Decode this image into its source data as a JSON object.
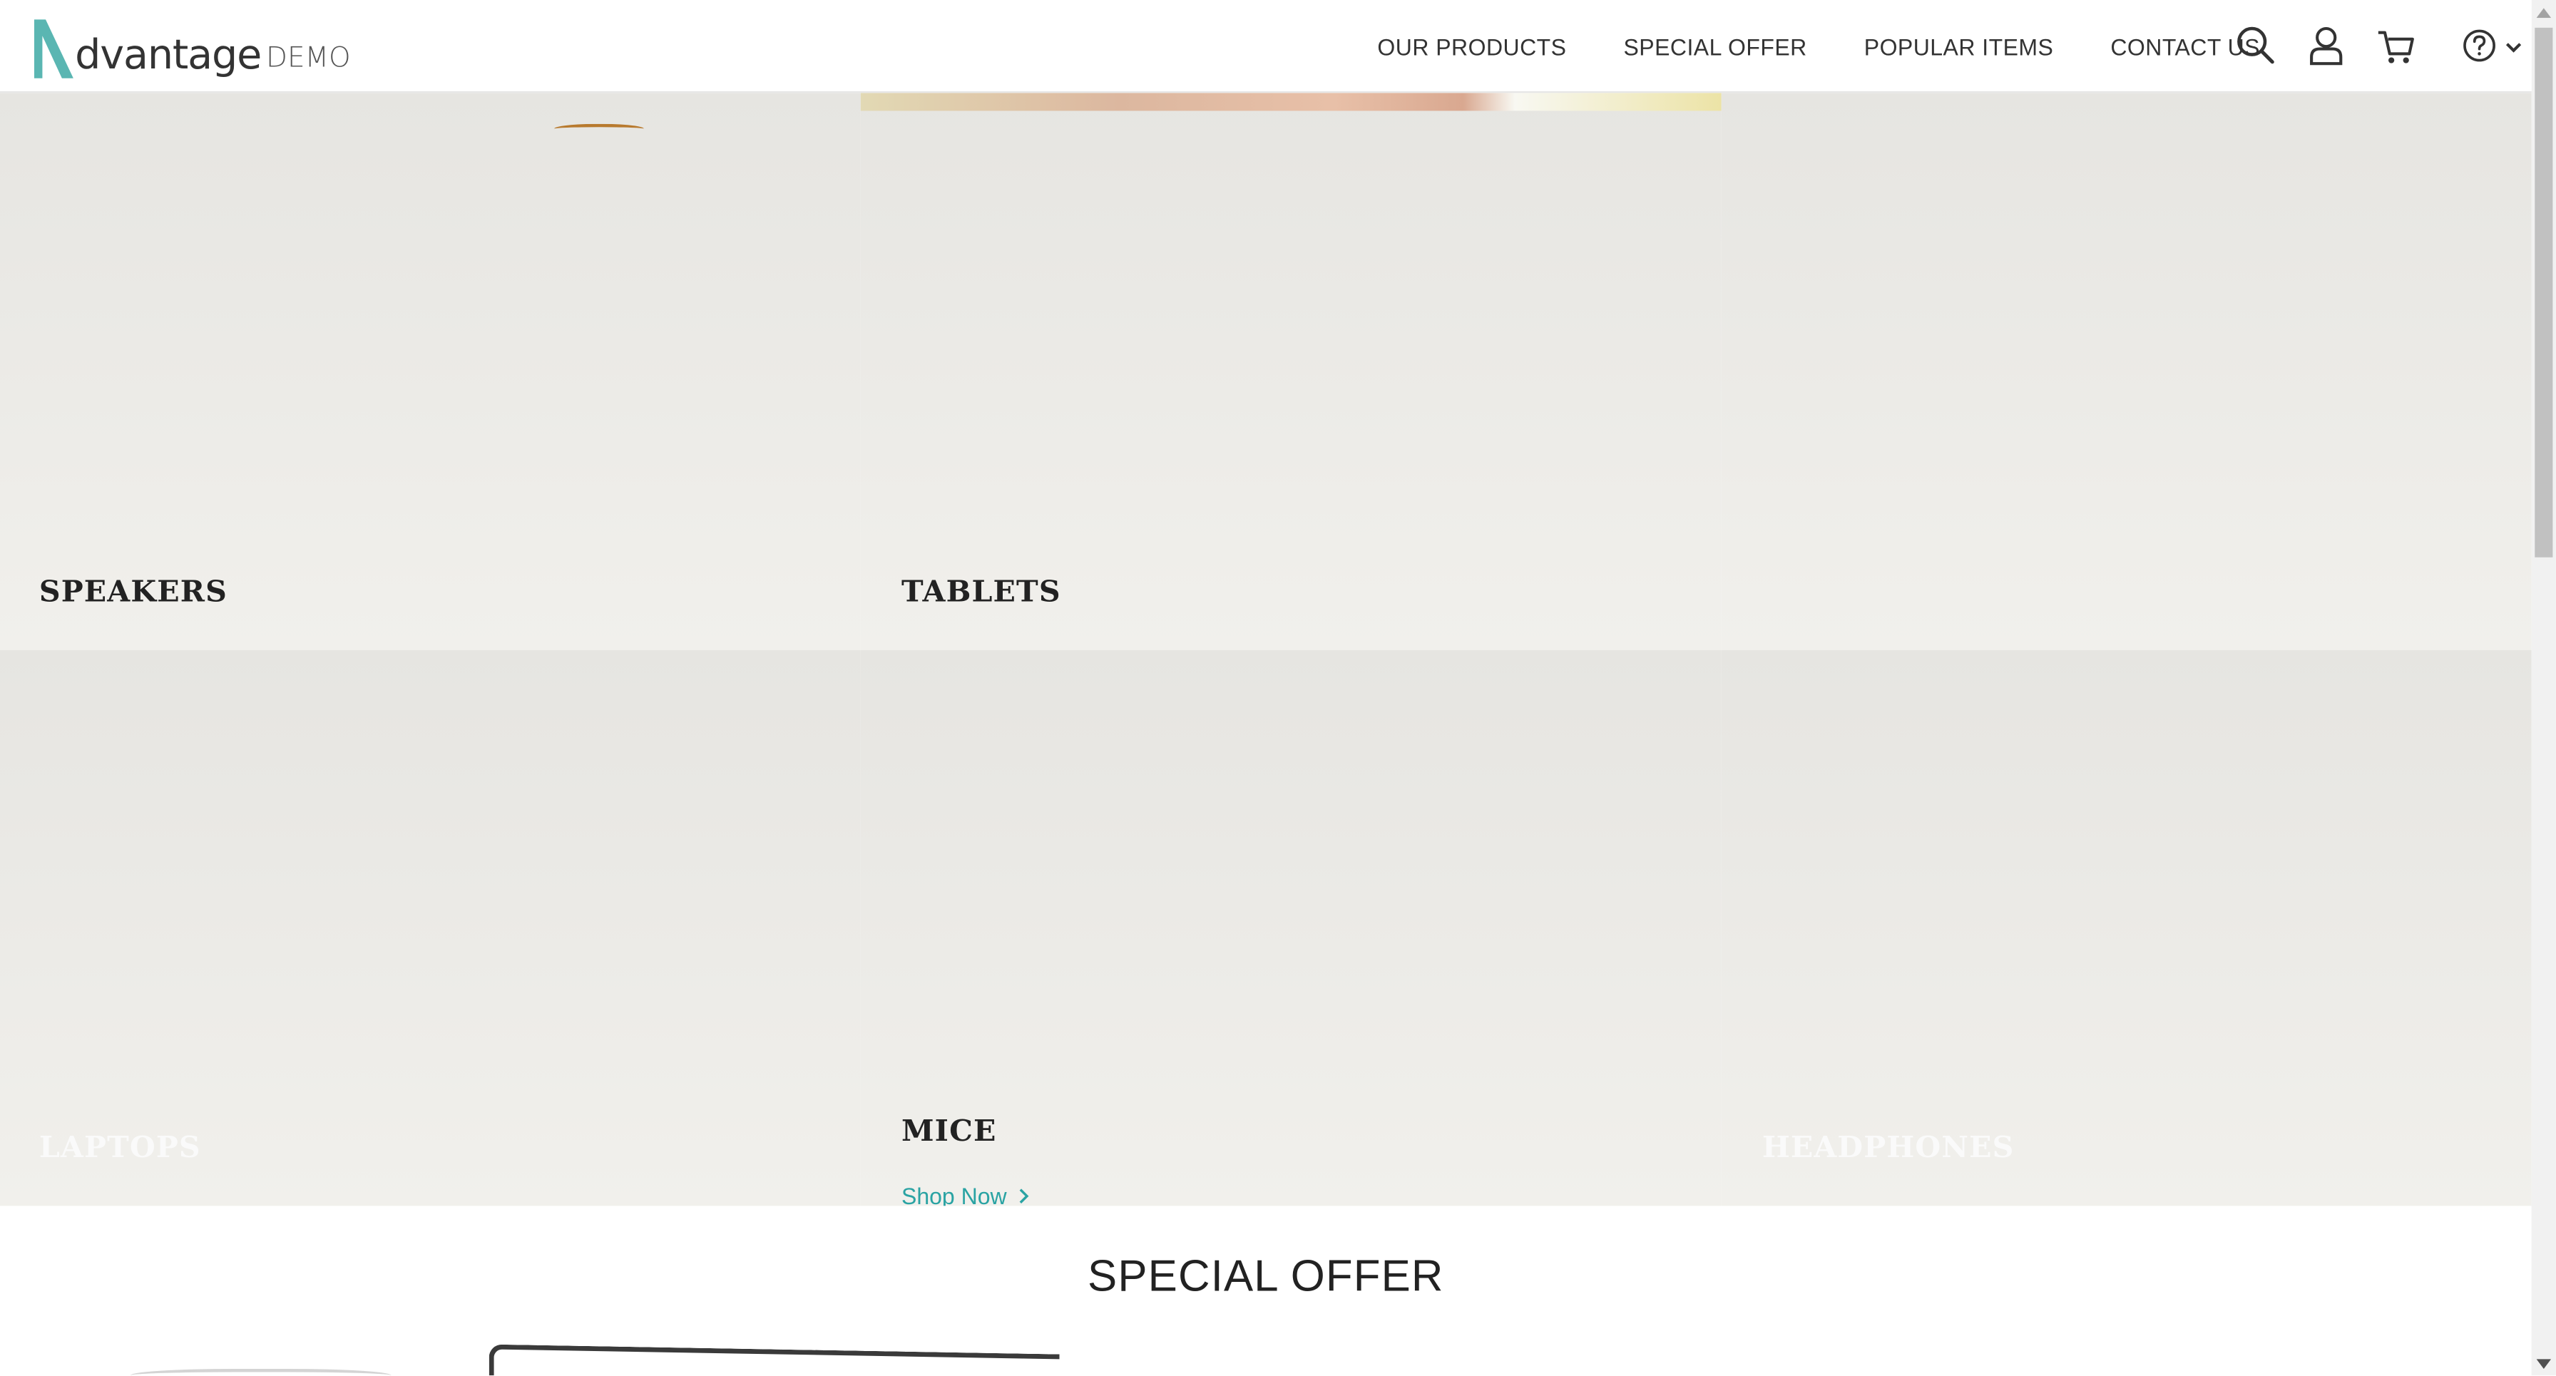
{
  "header": {
    "logo": {
      "main": "dvantage",
      "demo": "DEMO",
      "letter": "A"
    },
    "nav": [
      {
        "label": "OUR PRODUCTS"
      },
      {
        "label": "SPECIAL OFFER"
      },
      {
        "label": "POPULAR ITEMS"
      },
      {
        "label": "CONTACT US"
      }
    ],
    "icons": [
      "search-icon",
      "user-icon",
      "cart-icon",
      "help-icon",
      "chevron-down-icon"
    ]
  },
  "categories": {
    "speakers": {
      "title": "SPEAKERS"
    },
    "tablets": {
      "title": "TABLETS"
    },
    "laptops": {
      "title": "LAPTOPS"
    },
    "mice": {
      "title": "MICE",
      "cta": "Shop Now"
    },
    "headphones": {
      "title": "HEADPHONES"
    }
  },
  "special_offer": {
    "title": "SPECIAL OFFER"
  },
  "colors": {
    "accent": "#2aa3a3",
    "logo_teal": "#5ab6b2",
    "text_dark": "#222222"
  }
}
